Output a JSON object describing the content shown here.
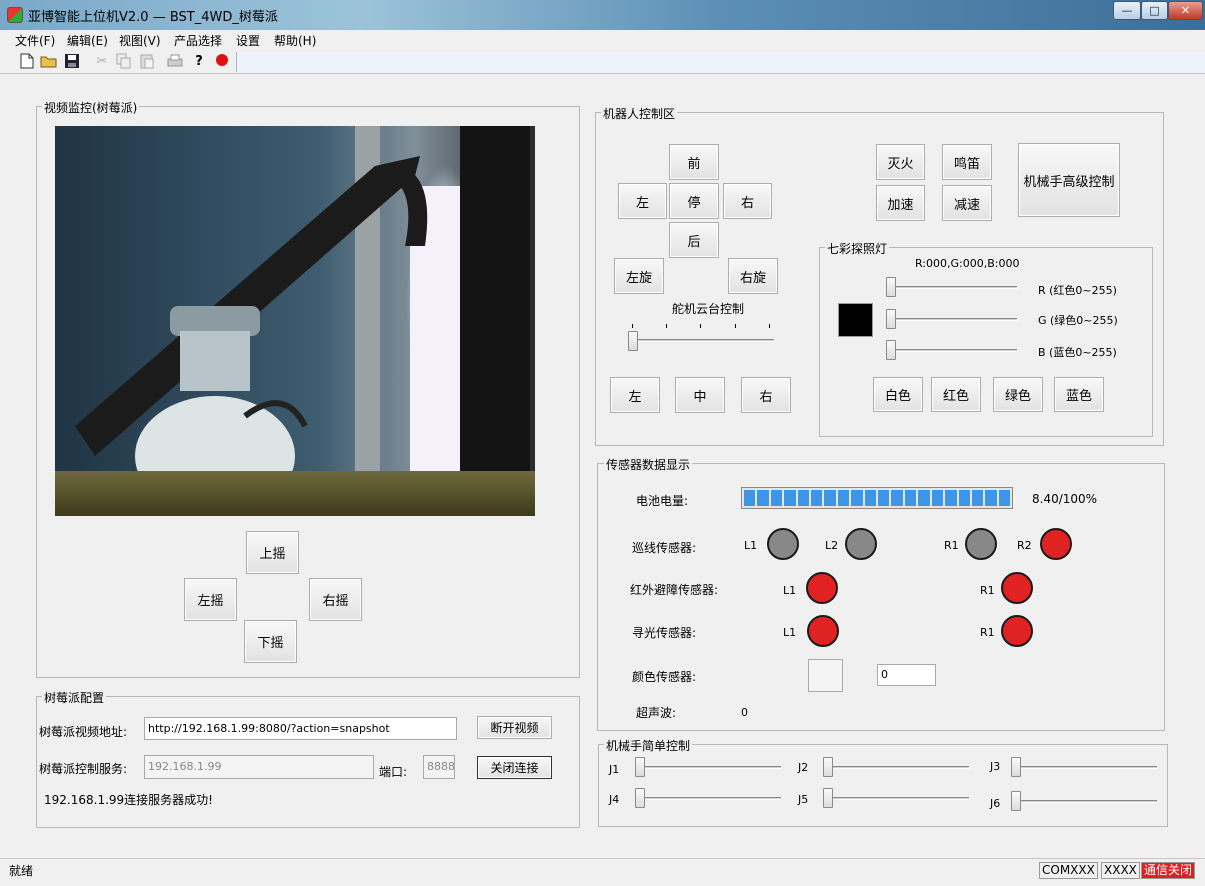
{
  "window": {
    "title": "亚博智能上位机V2.0 — BST_4WD_树莓派",
    "minimize": "—",
    "maximize": "□",
    "close": "✕"
  },
  "menu": [
    "文件(F)",
    "编辑(E)",
    "视图(V)",
    "产品选择",
    "设置",
    "帮助(H)"
  ],
  "toolbar_icons": [
    "new-file-icon",
    "open-folder-icon",
    "save-icon",
    "cut-icon",
    "copy-icon",
    "paste-icon",
    "print-icon",
    "help-icon",
    "record-icon"
  ],
  "video": {
    "group_label": "视频监控(树莓派)",
    "up": "上摇",
    "left": "左摇",
    "right": "右摇",
    "down": "下摇"
  },
  "pi_config": {
    "group_label": "树莓派配置",
    "video_addr_label": "树莓派视频地址:",
    "video_addr_value": "http://192.168.1.99:8080/?action=snapshot",
    "disconnect_video": "断开视频",
    "control_service_label": "树莓派控制服务:",
    "control_ip": "192.168.1.99",
    "port_label": "端口:",
    "port_value": "8888",
    "close_connection": "关闭连接",
    "status_message": "192.168.1.99连接服务器成功!"
  },
  "robot": {
    "group_label": "机器人控制区",
    "forward": "前",
    "left": "左",
    "stop": "停",
    "right": "右",
    "back": "后",
    "spin_left": "左旋",
    "spin_right": "右旋",
    "servo_label": "舵机云台控制",
    "servo_left": "左",
    "servo_center": "中",
    "servo_right": "右",
    "servo_level": 0,
    "fire_off": "灭火",
    "horn": "鸣笛",
    "speed_up": "加速",
    "speed_down": "减速",
    "arm_advanced": "机械手高级控制"
  },
  "rgb": {
    "group_label": "七彩探照灯",
    "readout": "R:000,G:000,B:000",
    "r_label": "R (红色0~255)",
    "g_label": "G (绿色0~255)",
    "b_label": "B (蓝色0~255)",
    "r": 0,
    "g": 0,
    "b": 0,
    "swatch_color": "#000000",
    "white": "白色",
    "red": "红色",
    "green": "绿色",
    "blue": "蓝色"
  },
  "sensors": {
    "group_label": "传感器数据显示",
    "battery_label": "电池电量:",
    "battery_text": "8.40/100%",
    "battery_fraction": 1.0,
    "battery_color": "#3d95e8",
    "line_label": "巡线传感器:",
    "line_leds": [
      {
        "name": "L1",
        "state": "gray"
      },
      {
        "name": "L2",
        "state": "gray"
      },
      {
        "name": "R1",
        "state": "gray"
      },
      {
        "name": "R2",
        "state": "red"
      }
    ],
    "ir_label": "红外避障传感器:",
    "ir_leds": [
      {
        "name": "L1",
        "state": "red"
      },
      {
        "name": "R1",
        "state": "red"
      }
    ],
    "light_label": "寻光传感器:",
    "light_leds": [
      {
        "name": "L1",
        "state": "red"
      },
      {
        "name": "R1",
        "state": "red"
      }
    ],
    "color_label": "颜色传感器:",
    "color_value": "0",
    "ultrasonic_label": "超声波:",
    "ultrasonic_value": "0"
  },
  "arm": {
    "group_label": "机械手简单控制",
    "joints": [
      {
        "name": "J1",
        "level": 0
      },
      {
        "name": "J2",
        "level": 0
      },
      {
        "name": "J3",
        "level": 0
      },
      {
        "name": "J4",
        "level": 0
      },
      {
        "name": "J5",
        "level": 0
      },
      {
        "name": "J6",
        "level": 0
      }
    ]
  },
  "status": {
    "ready": "就绪",
    "com": "COMXXX",
    "baud": "XXXX",
    "link": "通信关闭",
    "link_color": "#e02020"
  }
}
